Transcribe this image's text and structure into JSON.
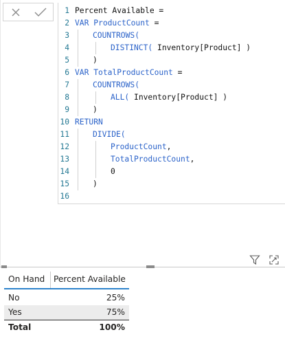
{
  "formula_bar": {
    "cancel_icon": "close-icon",
    "commit_icon": "checkmark-icon",
    "lines": [
      {
        "n": "1",
        "indent": 0,
        "parts": [
          {
            "t": "Percent Available =",
            "c": "txt"
          }
        ]
      },
      {
        "n": "2",
        "indent": 0,
        "parts": [
          {
            "t": "VAR ",
            "c": "kw"
          },
          {
            "t": "ProductCount",
            "c": "var"
          },
          {
            "t": " =",
            "c": "txt"
          }
        ]
      },
      {
        "n": "3",
        "indent": 1,
        "parts": [
          {
            "t": "COUNTROWS(",
            "c": "fn"
          }
        ]
      },
      {
        "n": "4",
        "indent": 2,
        "parts": [
          {
            "t": "DISTINCT(",
            "c": "fn"
          },
          {
            "t": " Inventory[Product] )",
            "c": "txt"
          }
        ]
      },
      {
        "n": "5",
        "indent": 1,
        "parts": [
          {
            "t": ")",
            "c": "txt"
          }
        ]
      },
      {
        "n": "6",
        "indent": 0,
        "parts": [
          {
            "t": "VAR ",
            "c": "kw"
          },
          {
            "t": "TotalProductCount",
            "c": "var"
          },
          {
            "t": " =",
            "c": "txt"
          }
        ]
      },
      {
        "n": "7",
        "indent": 1,
        "parts": [
          {
            "t": "COUNTROWS(",
            "c": "fn"
          }
        ]
      },
      {
        "n": "8",
        "indent": 2,
        "parts": [
          {
            "t": "ALL(",
            "c": "fn"
          },
          {
            "t": " Inventory[Product] )",
            "c": "txt"
          }
        ]
      },
      {
        "n": "9",
        "indent": 1,
        "parts": [
          {
            "t": ")",
            "c": "txt"
          }
        ]
      },
      {
        "n": "10",
        "indent": 0,
        "parts": [
          {
            "t": "RETURN",
            "c": "kw"
          }
        ]
      },
      {
        "n": "11",
        "indent": 1,
        "parts": [
          {
            "t": "DIVIDE(",
            "c": "fn"
          }
        ]
      },
      {
        "n": "12",
        "indent": 2,
        "parts": [
          {
            "t": "ProductCount",
            "c": "var"
          },
          {
            "t": ",",
            "c": "txt"
          }
        ]
      },
      {
        "n": "13",
        "indent": 2,
        "parts": [
          {
            "t": "TotalProductCount",
            "c": "var"
          },
          {
            "t": ",",
            "c": "txt"
          }
        ]
      },
      {
        "n": "14",
        "indent": 2,
        "parts": [
          {
            "t": "0",
            "c": "txt"
          }
        ]
      },
      {
        "n": "15",
        "indent": 1,
        "parts": [
          {
            "t": ")",
            "c": "txt"
          }
        ]
      },
      {
        "n": "16",
        "indent": 0,
        "parts": []
      }
    ]
  },
  "visual_header": {
    "filter_icon": "filter-icon",
    "focus_icon": "focus-mode-icon"
  },
  "table": {
    "headers": [
      "On Hand",
      "Percent Available"
    ],
    "rows": [
      {
        "on_hand": "No",
        "percent": "25%"
      },
      {
        "on_hand": "Yes",
        "percent": "75%"
      }
    ],
    "total": {
      "label": "Total",
      "percent": "100%"
    }
  },
  "colors": {
    "keyword": "#2a62c9",
    "line_number": "#237893",
    "header_accent": "#2c82cc"
  }
}
